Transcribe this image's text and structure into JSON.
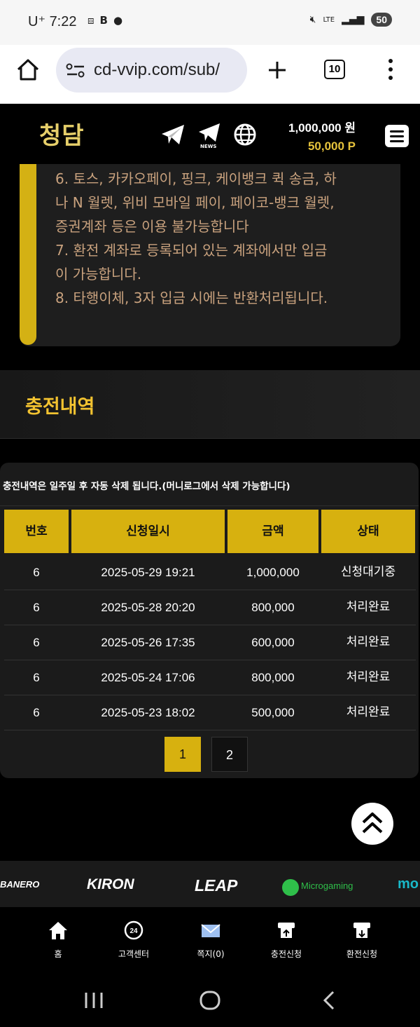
{
  "status": {
    "carrier": "U⁺",
    "time": "7:22",
    "battery": "50",
    "lte": "LTE"
  },
  "browser": {
    "url": "cd-vvip.com/sub/",
    "tab_count": "10"
  },
  "header": {
    "logo": "청담",
    "news_label": "NEWS",
    "balance": "1,000,000 원",
    "points": "50,000 P"
  },
  "notice": {
    "lines": [
      "6. 토스, 카카오페이, 핑크, 케이뱅크 퀵 송금, 하",
      "나 N 월렛, 위비 모바일 페이, 페이코-뱅크 월렛,",
      "증권계좌 등은 이용 불가능합니다",
      "7. 환전 계좌로 등록되어 있는 계좌에서만 입금",
      "이 가능합니다.",
      "8. 타행이체, 3자 입금 시에는 반환처리됩니다."
    ]
  },
  "section": {
    "title": "충전내역"
  },
  "history": {
    "info": "충전내역은 일주일 후 자동 삭제 됩니다.(머니로그에서 삭제 가능합니다)",
    "columns": [
      "번호",
      "신청일시",
      "금액",
      "상태"
    ],
    "rows": [
      {
        "no": "6",
        "date": "2025-05-29 19:21",
        "amount": "1,000,000",
        "status": "신청대기중"
      },
      {
        "no": "6",
        "date": "2025-05-28 20:20",
        "amount": "800,000",
        "status": "처리완료"
      },
      {
        "no": "6",
        "date": "2025-05-26 17:35",
        "amount": "600,000",
        "status": "처리완료"
      },
      {
        "no": "6",
        "date": "2025-05-24 17:06",
        "amount": "800,000",
        "status": "처리완료"
      },
      {
        "no": "6",
        "date": "2025-05-23 18:02",
        "amount": "500,000",
        "status": "처리완료"
      }
    ],
    "pages": [
      "1",
      "2"
    ]
  },
  "providers": [
    "BANERO",
    "KIRON",
    "LEAP",
    "Microgaming",
    "mo"
  ],
  "bottom_nav": [
    "홈",
    "고객센터",
    "쪽지(0)",
    "충전신청",
    "환전신청"
  ],
  "colors": {
    "gold": "#d7b10f",
    "accent_text": "#f2c230",
    "notice_text": "#c9a27e"
  }
}
